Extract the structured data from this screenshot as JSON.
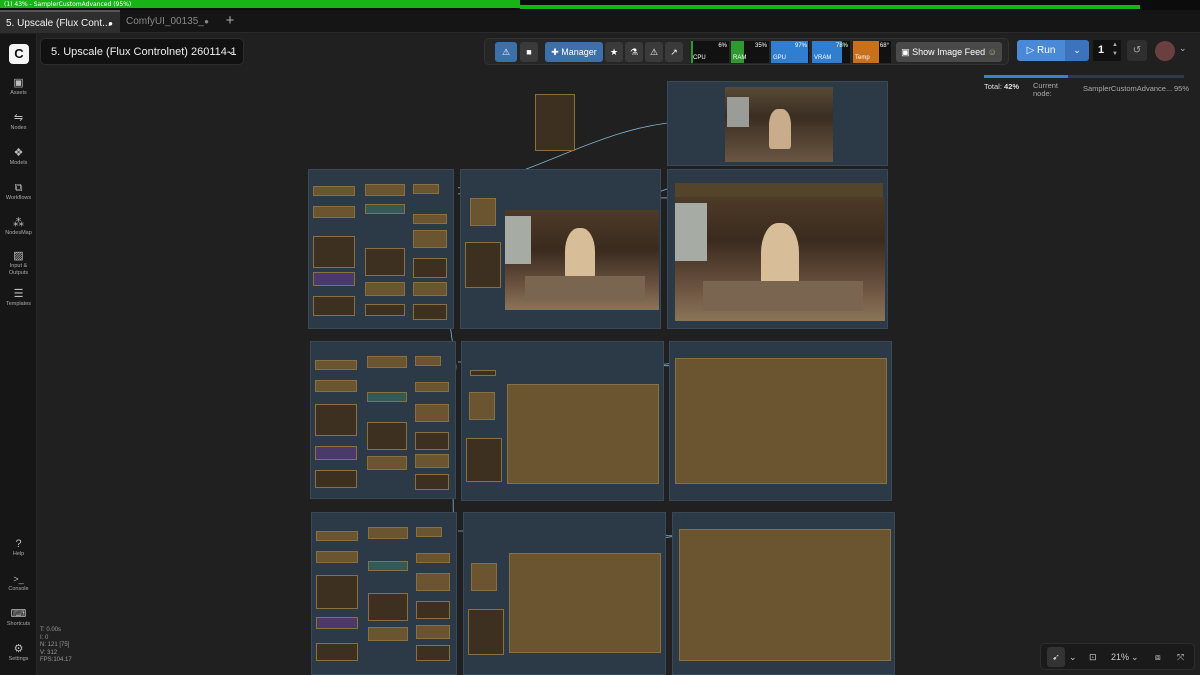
{
  "window": {
    "title_strip": "(1) 43% - SamplerCustomAdvanced (95%)"
  },
  "tabs": [
    {
      "label": "5. Upscale (Flux Cont...",
      "marker": "●"
    },
    {
      "label": "ComfyUI_00135_",
      "marker": "●"
    }
  ],
  "new_tab_icon": "plus-icon",
  "sidebar": {
    "items": [
      {
        "label": "Assets",
        "icon": "assets-icon",
        "glyph": "▣"
      },
      {
        "label": "Nodes",
        "icon": "nodes-icon",
        "glyph": "⇋"
      },
      {
        "label": "Models",
        "icon": "models-icon",
        "glyph": "❖"
      },
      {
        "label": "Workflows",
        "icon": "workflows-icon",
        "glyph": "⧉"
      },
      {
        "label": "NodesMap",
        "icon": "nodesmap-icon",
        "glyph": "⁂"
      },
      {
        "label": "Input & Outputs",
        "icon": "image-icon",
        "glyph": "▨"
      },
      {
        "label": "Templates",
        "icon": "templates-icon",
        "glyph": "☰"
      }
    ],
    "bottom_items": [
      {
        "label": "Help",
        "icon": "help-icon",
        "glyph": "?"
      },
      {
        "label": "Console",
        "icon": "console-icon",
        "glyph": ">_"
      },
      {
        "label": "Shortcuts",
        "icon": "keyboard-icon",
        "glyph": "⌨"
      },
      {
        "label": "Settings",
        "icon": "gear-icon",
        "glyph": "⚙"
      }
    ]
  },
  "workflow": {
    "title": "5. Upscale (Flux Controlnet) 260114-1"
  },
  "toolbar": {
    "manager_label": "Manager",
    "show_image_feed_label": "Show Image Feed",
    "meters": [
      {
        "name": "CPU",
        "value": "6%",
        "level": 0.06,
        "color": "#2f9a2f"
      },
      {
        "name": "RAM",
        "value": "35%",
        "level": 0.35,
        "color": "#2f9a2f"
      },
      {
        "name": "GPU",
        "value": "97%",
        "level": 0.97,
        "color": "#2f7ed0"
      },
      {
        "name": "VRAM",
        "value": "78%",
        "level": 0.78,
        "color": "#2f7ed0"
      },
      {
        "name": "Temp",
        "value": "68°",
        "level": 0.68,
        "color": "#c9701a"
      }
    ]
  },
  "run": {
    "label": "Run",
    "batch_count": "1"
  },
  "progress": {
    "total_label": "Total:",
    "total_value": "42%",
    "total_fraction": 0.42,
    "current_label": "Current node:",
    "node_name": "SamplerCustomAdvance...",
    "node_percent": "95%"
  },
  "stats": {
    "lines": [
      "T: 0.00s",
      "I: 0",
      "N: 121 [75]",
      "V: 312",
      "FPS:104.17"
    ]
  },
  "canvas_controls": {
    "zoom": "21%"
  },
  "colors": {
    "accent_blue": "#3d6fa8",
    "group_fill": "#2c3946",
    "node_fill": "#6b5530",
    "progress_green": "#17b317"
  }
}
